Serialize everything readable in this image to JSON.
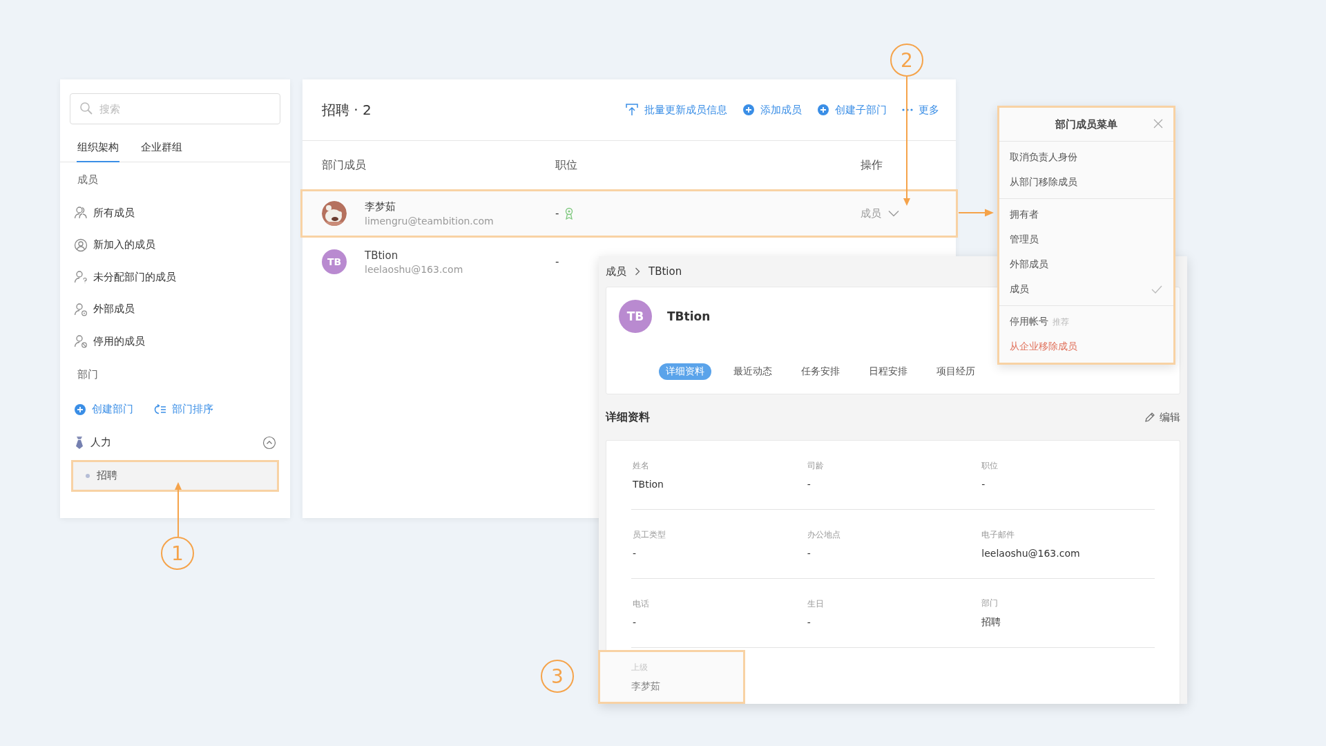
{
  "sidebar": {
    "search": {
      "placeholder": "搜索"
    },
    "tabs": [
      {
        "label": "组织架构",
        "selected": true
      },
      {
        "label": "企业群组",
        "selected": false
      }
    ],
    "members_heading": "成员",
    "member_items": [
      {
        "label": "所有成员",
        "kind": "all"
      },
      {
        "label": "新加入的成员",
        "kind": "new"
      },
      {
        "label": "未分配部门的成员",
        "kind": "unassigned"
      },
      {
        "label": "外部成员",
        "kind": "external"
      },
      {
        "label": "停用的成员",
        "kind": "disabled"
      }
    ],
    "departments_heading": "部门",
    "actions": [
      {
        "label": "创建部门",
        "kind": "create"
      },
      {
        "label": "部门排序",
        "kind": "sort"
      }
    ],
    "tree": [
      {
        "label": "人力",
        "expanded": true,
        "children": [
          {
            "label": "招聘",
            "selected": true,
            "highlighted": true
          }
        ]
      }
    ]
  },
  "main": {
    "title": "招聘 · 2",
    "actions": [
      {
        "label": "批量更新成员信息",
        "kind": "upload"
      },
      {
        "label": "添加成员",
        "kind": "add"
      },
      {
        "label": "创建子部门",
        "kind": "add"
      },
      {
        "label": "更多",
        "kind": "more"
      }
    ],
    "columns": [
      "部门成员",
      "职位",
      "操作"
    ],
    "rows": [
      {
        "name": "李梦茹",
        "email": "limengru@teambition.com",
        "position": "-",
        "badge": true,
        "role": "成员",
        "kind": "picture",
        "highlighted": true
      },
      {
        "name": "TBtion",
        "email": "leelaoshu@163.com",
        "position": "-",
        "badge": false,
        "kind": "initials",
        "initials": "TB",
        "highlighted": false
      }
    ]
  },
  "detail": {
    "breadcrumb": [
      "成员",
      "TBtion"
    ],
    "initials": "TB",
    "name": "TBtion",
    "tabs": [
      {
        "label": "详细资料",
        "selected": true
      },
      {
        "label": "最近动态",
        "selected": false
      },
      {
        "label": "任务安排",
        "selected": false
      },
      {
        "label": "日程安排",
        "selected": false
      },
      {
        "label": "项目经历",
        "selected": false
      }
    ],
    "section_title": "详细资料",
    "edit": "编辑",
    "fields": [
      {
        "label": "姓名",
        "value": "TBtion",
        "highlighted": false
      },
      {
        "label": "司龄",
        "value": "-",
        "highlighted": false
      },
      {
        "label": "职位",
        "value": "-",
        "highlighted": false
      },
      {
        "label": "员工类型",
        "value": "-",
        "highlighted": false
      },
      {
        "label": "办公地点",
        "value": "-",
        "highlighted": false
      },
      {
        "label": "电子邮件",
        "value": "leelaoshu@163.com",
        "highlighted": false
      },
      {
        "label": "电话",
        "value": "-",
        "highlighted": false
      },
      {
        "label": "生日",
        "value": "-",
        "highlighted": false
      },
      {
        "label": "部门",
        "value": "招聘",
        "highlighted": false
      },
      {
        "label": "上级",
        "value": "李梦茹",
        "highlighted": true
      }
    ]
  },
  "menu": {
    "title": "部门成员菜单",
    "groups": [
      [
        {
          "label": "取消负责人身份",
          "kind": "normal"
        },
        {
          "label": "从部门移除成员",
          "kind": "normal"
        }
      ],
      [
        {
          "label": "拥有者",
          "kind": "role",
          "checked": false
        },
        {
          "label": "管理员",
          "kind": "role",
          "checked": false
        },
        {
          "label": "外部成员",
          "kind": "role",
          "checked": false
        },
        {
          "label": "成员",
          "kind": "role",
          "checked": true
        }
      ],
      [
        {
          "label": "停用帐号",
          "kind": "normal",
          "tag": "推荐"
        },
        {
          "label": "从企业移除成员",
          "kind": "danger"
        }
      ]
    ]
  },
  "callouts": [
    {
      "number": "1"
    },
    {
      "number": "2"
    },
    {
      "number": "3"
    }
  ]
}
